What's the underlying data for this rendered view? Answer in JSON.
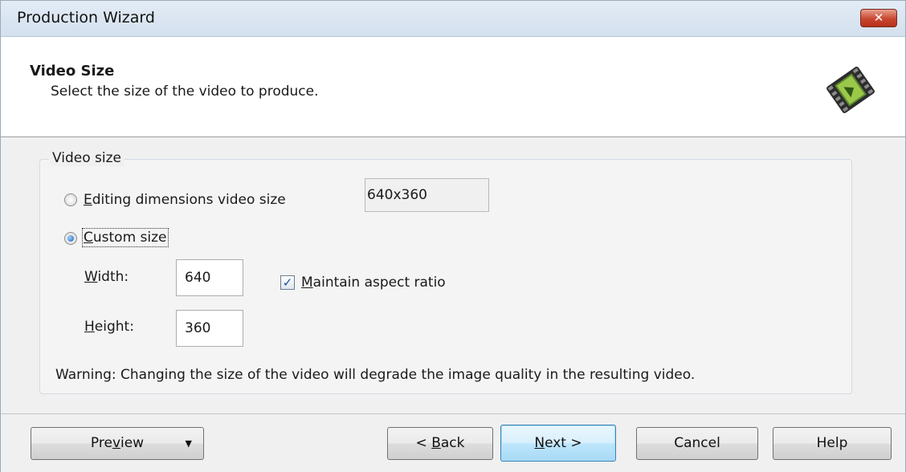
{
  "window": {
    "title": "Production Wizard",
    "close_glyph": "✕"
  },
  "header": {
    "title": "Video Size",
    "subtitle": "Select the size of the video to produce.",
    "icon": "film-strip-icon"
  },
  "video_size": {
    "group_label": "Video size",
    "editing_option": {
      "pre": "",
      "mnemonic": "E",
      "post": "diting dimensions video size",
      "checked": false
    },
    "editing_value": "640x360",
    "custom_option": {
      "pre": "",
      "mnemonic": "C",
      "post": "ustom size",
      "checked": true
    },
    "width": {
      "pre": "",
      "mnemonic": "W",
      "post": "idth:",
      "value": "640"
    },
    "height": {
      "pre": "",
      "mnemonic": "H",
      "post": "eight:",
      "value": "360"
    },
    "aspect": {
      "pre": "",
      "mnemonic": "M",
      "post": "aintain aspect ratio",
      "checked": true,
      "mark": "✓"
    },
    "warning": "Warning: Changing the size of the video will degrade the image quality in the resulting video."
  },
  "buttons": {
    "preview": {
      "pre": "Pre",
      "mnemonic": "v",
      "post": "iew",
      "arrow": "▼"
    },
    "back": {
      "pre": "< ",
      "mnemonic": "B",
      "post": "ack"
    },
    "next": {
      "pre": "",
      "mnemonic": "N",
      "post": "ext >"
    },
    "cancel": "Cancel",
    "help": "Help"
  },
  "colors": {
    "accent": "#3c7fb1",
    "close": "#c9462f",
    "background": "#f0f0f0"
  }
}
